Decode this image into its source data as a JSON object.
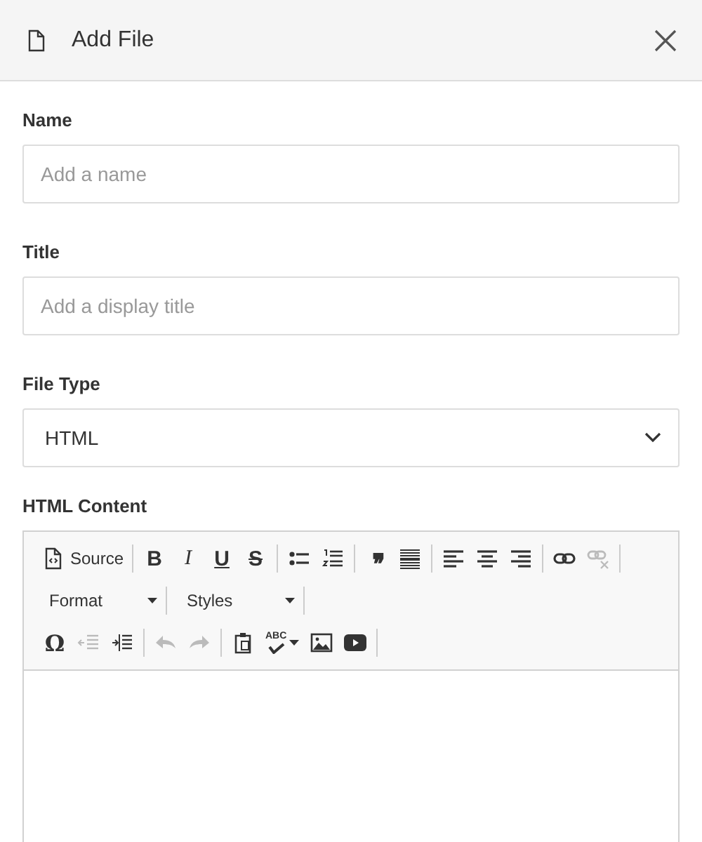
{
  "dialog": {
    "title": "Add File"
  },
  "fields": [
    {
      "kind": "text",
      "label": "Name",
      "placeholder": "Add a name"
    },
    {
      "kind": "text",
      "label": "Title",
      "placeholder": "Add a display title"
    },
    {
      "kind": "select",
      "label": "File Type",
      "value": "HTML"
    }
  ],
  "editor": {
    "label": "HTML Content",
    "toolbar_rows": [
      [
        [
          {
            "kind": "source",
            "label": "Source",
            "disabled": false
          }
        ],
        [
          {
            "kind": "bold",
            "label": "B",
            "disabled": false
          },
          {
            "kind": "italic",
            "label": "I",
            "disabled": false
          },
          {
            "kind": "underline",
            "label": "U",
            "disabled": false
          },
          {
            "kind": "strike",
            "label": "S",
            "disabled": false
          }
        ],
        [
          {
            "kind": "bullets",
            "disabled": false
          },
          {
            "kind": "numbers",
            "disabled": false
          }
        ],
        [
          {
            "kind": "quote",
            "label": "❜❜",
            "disabled": false
          },
          {
            "kind": "rule",
            "disabled": false
          }
        ],
        [
          {
            "kind": "alignleft",
            "disabled": false
          },
          {
            "kind": "aligncenter",
            "disabled": false
          },
          {
            "kind": "alignright",
            "disabled": false
          }
        ],
        [
          {
            "kind": "link",
            "disabled": false
          },
          {
            "kind": "unlink",
            "disabled": true
          }
        ]
      ],
      [
        [
          {
            "kind": "dropdown",
            "label": "Format",
            "disabled": false
          }
        ],
        [
          {
            "kind": "dropdown",
            "label": "Styles",
            "disabled": false
          }
        ]
      ],
      [
        [
          {
            "kind": "letter",
            "label": "Ω",
            "disabled": false
          },
          {
            "kind": "outdent",
            "disabled": true
          },
          {
            "kind": "indent",
            "disabled": false
          }
        ],
        [
          {
            "kind": "undo",
            "disabled": true
          },
          {
            "kind": "redo",
            "disabled": true
          }
        ],
        [
          {
            "kind": "paste",
            "disabled": false
          },
          {
            "kind": "spell",
            "label": "ABC",
            "disabled": false
          },
          {
            "kind": "image",
            "disabled": false
          },
          {
            "kind": "video",
            "disabled": false
          }
        ]
      ]
    ]
  }
}
